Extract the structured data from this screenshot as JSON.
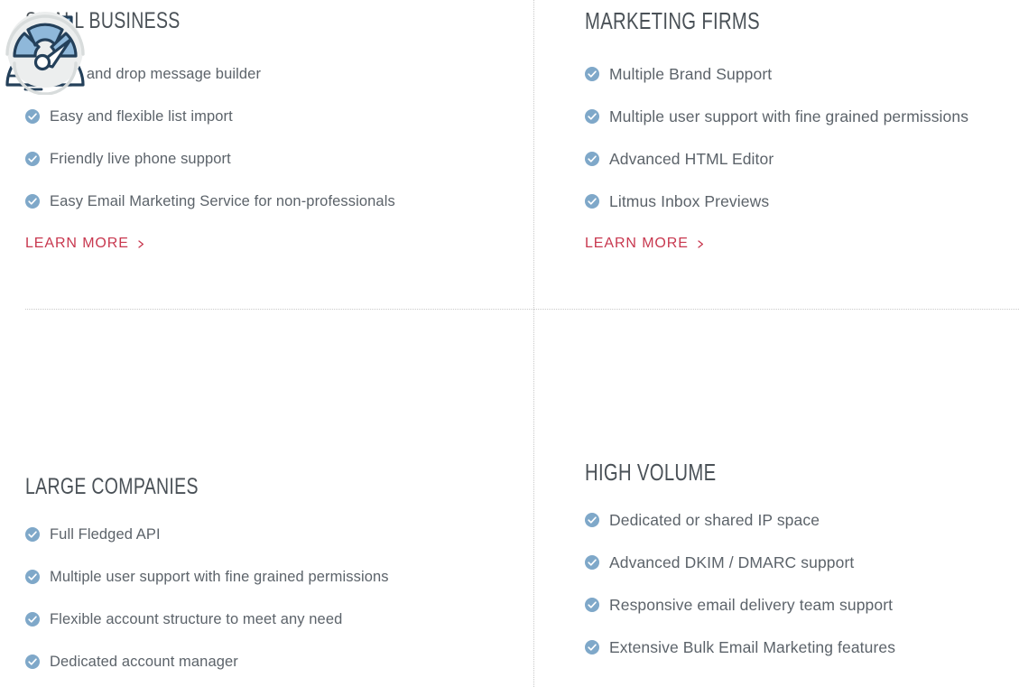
{
  "theme": {
    "accent_link_color": "#c8384f",
    "check_color": "#7fa8c9",
    "heading_color": "#4a5157",
    "body_text_color": "#5c636a",
    "icon_navy": "#24405a",
    "icon_blue": "#7fabd0",
    "divider_color": "#c9c9c9",
    "background": "#ffffff"
  },
  "sections": {
    "small_business": {
      "heading": "SMALL BUSINESS",
      "features": [
        "Drag and drop message builder",
        "Easy and flexible list import",
        "Friendly live phone support",
        "Easy Email Marketing Service for non-professionals"
      ],
      "cta_label": "LEARN MORE"
    },
    "marketing_firms": {
      "heading": "MARKETING FIRMS",
      "features": [
        "Multiple Brand Support",
        "Multiple user support with fine grained permissions",
        "Advanced HTML Editor",
        "Litmus Inbox Previews"
      ],
      "cta_label": "LEARN MORE"
    },
    "large_companies": {
      "heading": "LARGE COMPANIES",
      "icon": "city-buildings-globe-icon",
      "features": [
        "Full Fledged API",
        "Multiple user support with fine grained permissions",
        "Flexible account structure to meet any need",
        "Dedicated account manager"
      ]
    },
    "high_volume": {
      "heading": "HIGH VOLUME",
      "icon": "speedometer-gauge-icon",
      "features": [
        "Dedicated or shared IP space",
        "Advanced DKIM / DMARC support",
        "Responsive email delivery team support",
        "Extensive Bulk Email Marketing features"
      ]
    }
  },
  "icons": {
    "check": "check-circle-icon",
    "chevron": "chevron-right-icon"
  }
}
